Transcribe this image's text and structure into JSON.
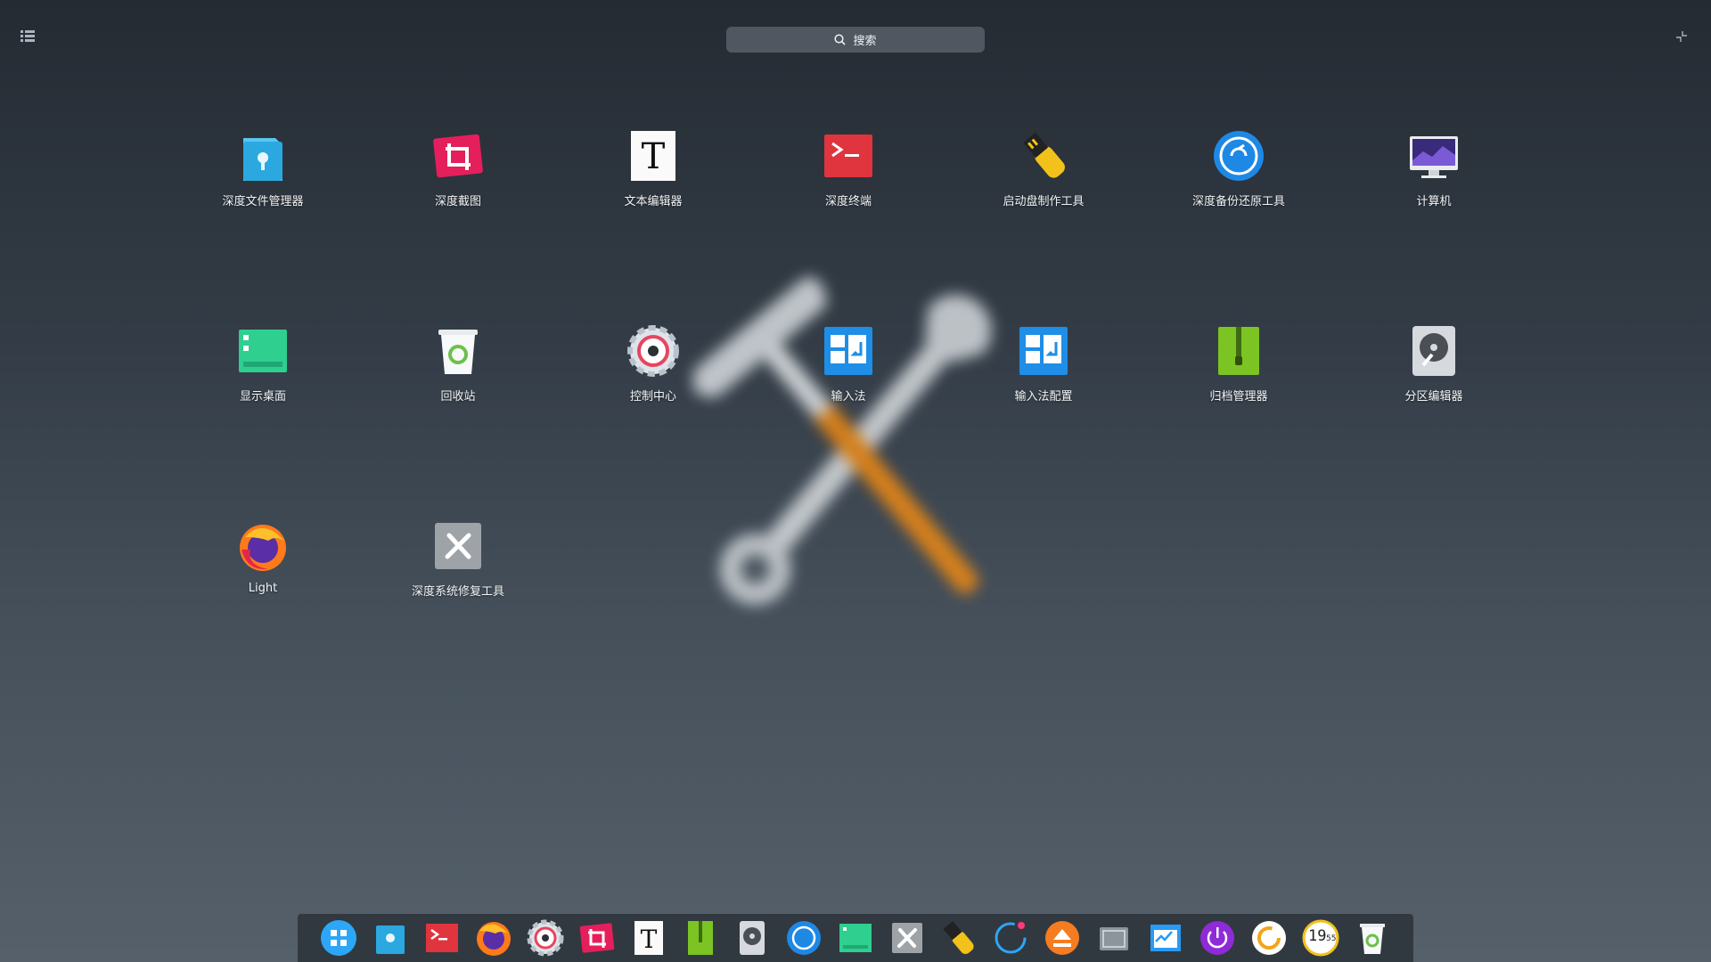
{
  "search": {
    "placeholder": "搜索",
    "icon": "search-icon"
  },
  "top_left_icon": "category-list-icon",
  "top_right_icon": "exit-fullscreen-icon",
  "apps": [
    {
      "label": "深度文件管理器",
      "icon": "file-manager-icon"
    },
    {
      "label": "深度截图",
      "icon": "screenshot-icon"
    },
    {
      "label": "文本编辑器",
      "icon": "text-editor-icon"
    },
    {
      "label": "深度终端",
      "icon": "terminal-icon"
    },
    {
      "label": "启动盘制作工具",
      "icon": "boot-maker-icon"
    },
    {
      "label": "深度备份还原工具",
      "icon": "backup-icon"
    },
    {
      "label": "计算机",
      "icon": "computer-icon"
    },
    {
      "label": "显示桌面",
      "icon": "show-desktop-icon"
    },
    {
      "label": "回收站",
      "icon": "trash-icon"
    },
    {
      "label": "控制中心",
      "icon": "control-center-icon"
    },
    {
      "label": "输入法",
      "icon": "input-method-icon"
    },
    {
      "label": "输入法配置",
      "icon": "input-method-config-icon"
    },
    {
      "label": "归档管理器",
      "icon": "archive-manager-icon"
    },
    {
      "label": "分区编辑器",
      "icon": "partition-editor-icon"
    },
    {
      "label": "Light",
      "icon": "firefox-icon"
    },
    {
      "label": "深度系统修复工具",
      "icon": "repair-tool-icon"
    }
  ],
  "dock": [
    "launcher-icon",
    "file-manager-icon",
    "terminal-icon",
    "firefox-icon",
    "control-center-icon",
    "screenshot-icon",
    "text-editor-icon",
    "archive-manager-icon",
    "partition-editor-icon",
    "backup-icon",
    "show-desktop-icon",
    "repair-tool-icon",
    "boot-maker-icon",
    "loading-icon",
    "eject-icon",
    "device-icon",
    "system-monitor-icon",
    "power-icon",
    "refresh-icon",
    "clock-icon",
    "trash-icon"
  ],
  "clock": {
    "text": "19",
    "sub": "55"
  },
  "colors": {
    "accent": "#2ca7f8",
    "terminal": "#e0343f",
    "archive": "#7bc423",
    "desktop": "#2ecf8f"
  }
}
